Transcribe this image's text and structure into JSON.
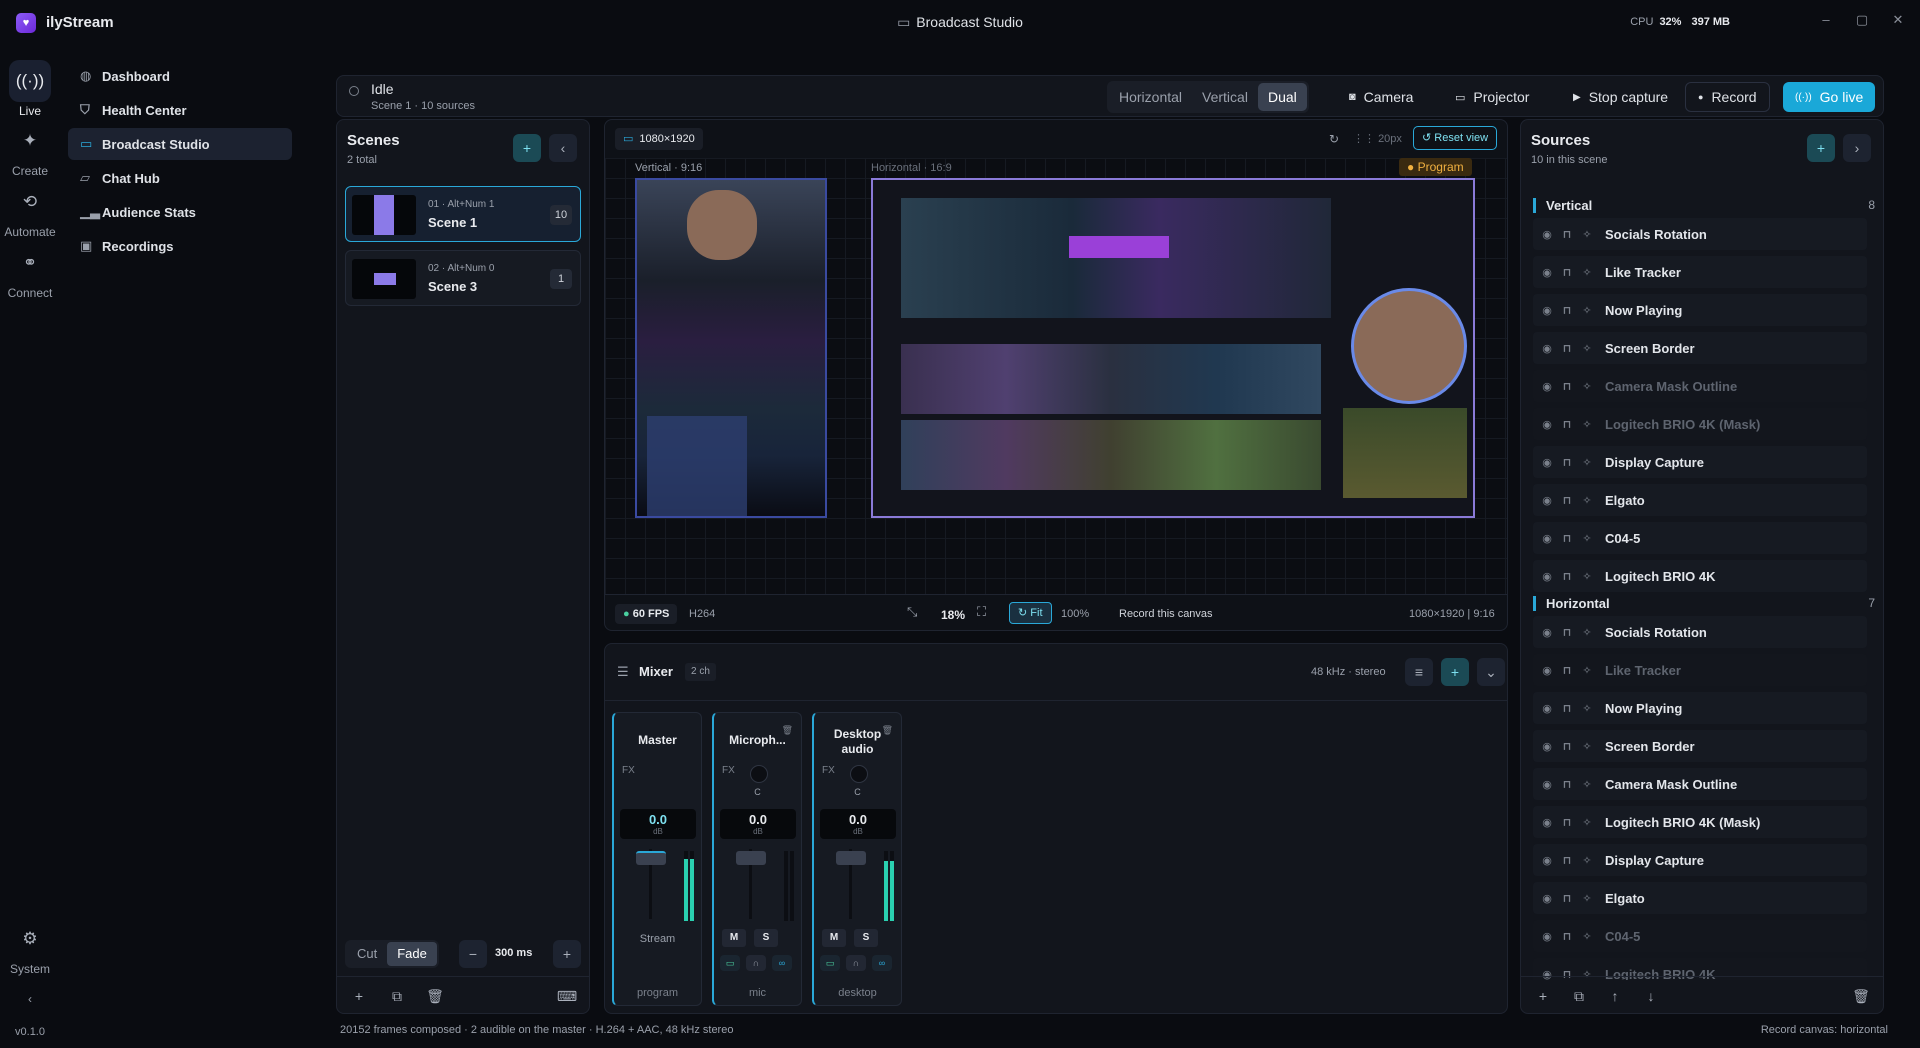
{
  "app": {
    "name": "ilyStream",
    "window_title": "Broadcast Studio",
    "cpu_label": "CPU",
    "cpu_value": "32%",
    "mem_value": "397 MB"
  },
  "rail": {
    "items": [
      {
        "label": "Live",
        "icon": "broadcast-icon"
      },
      {
        "label": "Create",
        "icon": "create-icon"
      },
      {
        "label": "Automate",
        "icon": "automate-icon"
      },
      {
        "label": "Connect",
        "icon": "connect-icon"
      }
    ],
    "system": "System",
    "version": "v0.1.0"
  },
  "nav": {
    "items": [
      {
        "label": "Dashboard"
      },
      {
        "label": "Health Center"
      },
      {
        "label": "Broadcast Studio"
      },
      {
        "label": "Chat Hub"
      },
      {
        "label": "Audience Stats"
      },
      {
        "label": "Recordings"
      }
    ]
  },
  "status": {
    "state": "Idle",
    "detail": "Scene 1 · 10 sources"
  },
  "layout_tabs": [
    "Horizontal",
    "Vertical",
    "Dual"
  ],
  "toolbar": {
    "camera": "Camera",
    "projector": "Projector",
    "stop_capture": "Stop capture",
    "record": "Record",
    "go_live": "Go live"
  },
  "scenes": {
    "title": "Scenes",
    "total": "2 total",
    "items": [
      {
        "hotkey": "01 · Alt+Num 1",
        "name": "Scene 1",
        "count": "10"
      },
      {
        "hotkey": "02 · Alt+Num 0",
        "name": "Scene 3",
        "count": "1"
      }
    ],
    "transition": {
      "cut": "Cut",
      "fade": "Fade",
      "duration": "300 ms"
    }
  },
  "canvas": {
    "resolution": "1080×1920",
    "grid": "20px",
    "reset": "Reset view",
    "vertical_label": "Vertical · 9:16",
    "horizontal_label": "Horizontal · 16:9",
    "program": "Program",
    "fps": "60 FPS",
    "codec": "H264",
    "zoom": "18%",
    "fit": "Fit",
    "full": "100%",
    "record_canvas": "Record this canvas",
    "size": "1080×1920",
    "ratio": "9:16"
  },
  "mixer": {
    "title": "Mixer",
    "channels": "2 ch",
    "format": "48 kHz · stereo",
    "strips": [
      {
        "name": "Master",
        "db": "0.0",
        "unit": "dB",
        "role": "Stream",
        "footer": "program"
      },
      {
        "name": "Microph...",
        "db": "0.0",
        "unit": "dB",
        "knob": "C",
        "footer": "mic"
      },
      {
        "name": "Desktop audio",
        "db": "0.0",
        "unit": "dB",
        "knob": "C",
        "footer": "desktop"
      }
    ],
    "mute": "M",
    "solo": "S",
    "fx": "FX"
  },
  "sources": {
    "title": "Sources",
    "subtitle": "10 in this scene",
    "groups": [
      {
        "name": "Vertical",
        "count": "8",
        "items": [
          {
            "name": "Socials Rotation",
            "dim": false
          },
          {
            "name": "Like Tracker",
            "dim": false
          },
          {
            "name": "Now Playing",
            "dim": false
          },
          {
            "name": "Screen Border",
            "dim": false
          },
          {
            "name": "Camera Mask Outline",
            "dim": true
          },
          {
            "name": "Logitech BRIO 4K (Mask)",
            "dim": true
          },
          {
            "name": "Display Capture",
            "dim": false
          },
          {
            "name": "Elgato",
            "dim": false
          },
          {
            "name": "C04-5",
            "dim": false
          },
          {
            "name": "Logitech BRIO 4K",
            "dim": false
          }
        ]
      },
      {
        "name": "Horizontal",
        "count": "7",
        "items": [
          {
            "name": "Socials Rotation",
            "dim": false
          },
          {
            "name": "Like Tracker",
            "dim": true
          },
          {
            "name": "Now Playing",
            "dim": false
          },
          {
            "name": "Screen Border",
            "dim": false
          },
          {
            "name": "Camera Mask Outline",
            "dim": false
          },
          {
            "name": "Logitech BRIO 4K (Mask)",
            "dim": false
          },
          {
            "name": "Display Capture",
            "dim": false
          },
          {
            "name": "Elgato",
            "dim": false
          },
          {
            "name": "C04-5",
            "dim": true
          },
          {
            "name": "Logitech BRIO 4K",
            "dim": true
          }
        ]
      }
    ]
  },
  "footer": {
    "left": "20152 frames composed · 2 audible on the master · H.264 + AAC, 48 kHz stereo",
    "right": "Record canvas: horizontal"
  },
  "accent": "#1aa8d8"
}
